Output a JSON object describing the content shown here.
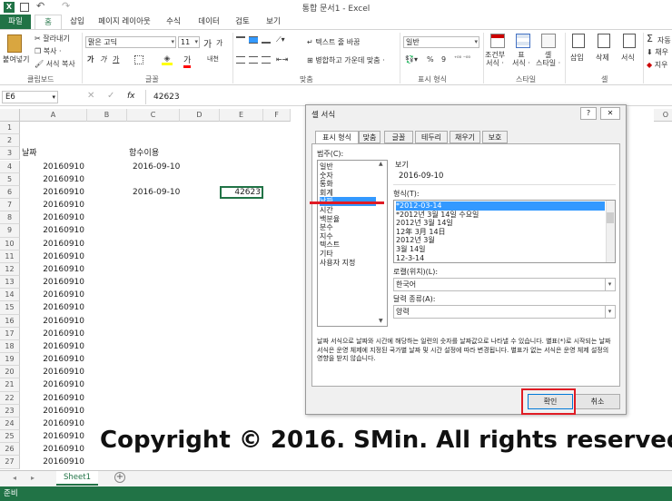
{
  "window": {
    "title": "통합 문서1 - Excel"
  },
  "ribbon_tabs": [
    "파일",
    "홈",
    "삽입",
    "페이지 레이아웃",
    "수식",
    "데이터",
    "검토",
    "보기"
  ],
  "ribbon": {
    "clipboard": {
      "paste": "붙여넣기",
      "cut": "잘라내기",
      "copy": "복사 ·",
      "format_painter": "서식 복사",
      "label": "클립보드"
    },
    "font": {
      "name": "맑은 고딕",
      "size": "11",
      "bold": "가",
      "italic": "가",
      "underline": "가",
      "grow": "가",
      "shrink": "가",
      "color_letter": "가",
      "phonetic": "내천",
      "label": "글꼴"
    },
    "align": {
      "wrap": "텍스트 줄 바꿈",
      "merge": "병합하고 가운데 맞춤 ·",
      "label": "맞춤"
    },
    "number": {
      "format": "일반",
      "percent": "%",
      "comma": "9",
      "label": "표시 형식"
    },
    "styles": {
      "conditional": "조건부\n서식 ·",
      "table": "표\n서식 ·",
      "cell": "셀\n스타일 ·",
      "label": "스타일"
    },
    "cells": {
      "insert": "삽입",
      "delete": "삭제",
      "format": "서식",
      "label": "셀"
    },
    "edit": {
      "sigma": "Σ",
      "fill": "채우",
      "clear": "지우"
    }
  },
  "formula_bar": {
    "cell_ref": "E6",
    "fx": "fx",
    "value": "42623"
  },
  "columns": [
    "A",
    "B",
    "C",
    "D",
    "E",
    "F"
  ],
  "rows": [
    "1",
    "2",
    "3",
    "4",
    "5",
    "6",
    "7",
    "8",
    "9",
    "10",
    "11",
    "12",
    "13",
    "14",
    "15",
    "16",
    "17",
    "18",
    "19",
    "20",
    "21",
    "22",
    "23",
    "24",
    "25",
    "26",
    "27"
  ],
  "cells": {
    "A3": "날짜",
    "C3": "함수이용",
    "A4": "20160910",
    "C4": "2016-09-10",
    "A5": "20160910",
    "A6": "20160910",
    "C6": "2016-09-10",
    "E6": "42623",
    "A7": "20160910",
    "A8": "20160910",
    "A9": "20160910",
    "A10": "20160910",
    "A11": "20160910",
    "A12": "20160910",
    "A13": "20160910",
    "A14": "20160910",
    "A15": "20160910",
    "A16": "20160910",
    "A17": "20160910",
    "A18": "20160910",
    "A19": "20160910",
    "A20": "20160910",
    "A21": "20160910",
    "A22": "20160910",
    "A23": "20160910",
    "A24": "20160910",
    "A25": "20160910",
    "A26": "20160910",
    "A27": "20160910"
  },
  "sheet_tabs": [
    "Sheet1"
  ],
  "status": "준비",
  "dialog": {
    "title": "셀 서식",
    "help": "?",
    "close": "✕",
    "tabs": [
      "표시 형식",
      "맞춤",
      "글꼴",
      "테두리",
      "채우기",
      "보호"
    ],
    "category_label": "범주(C):",
    "categories": [
      "일반",
      "숫자",
      "통화",
      "회계",
      "날짜",
      "시간",
      "백분율",
      "분수",
      "지수",
      "텍스트",
      "기타",
      "사용자 지정"
    ],
    "selected_category": "날짜",
    "preview_label": "보기",
    "preview_value": "2016-09-10",
    "type_label": "형식(T):",
    "types": [
      "*2012-03-14",
      "*2012년 3월 14일 수요일",
      "2012년 3월 14일",
      "12年 3月 14日",
      "2012년 3월",
      "3월 14일",
      "12-3-14"
    ],
    "locale_label": "로캘(위치)(L):",
    "locale_value": "한국어",
    "calendar_label": "달력 종류(A):",
    "calendar_value": "양력",
    "description": "날짜 서식으로 날짜와 시간에 해당하는 일련의 숫자를 날짜값으로 나타낼 수 있습니다. 별표(*)로 시작되는 날짜 서식은 운영 체제에 지정된 국가별 날짜 및 시간 설정에 따라 변경됩니다. 별표가 없는 서식은 운영 체제 설정의 영향을 받지 않습니다.",
    "ok": "확인",
    "cancel": "취소"
  },
  "watermark": "Copyright © 2016. SMin. All rights reserved.",
  "colors": {
    "excel_green": "#217346",
    "highlight": "#3399ff",
    "annotation_red": "#e01b24"
  }
}
